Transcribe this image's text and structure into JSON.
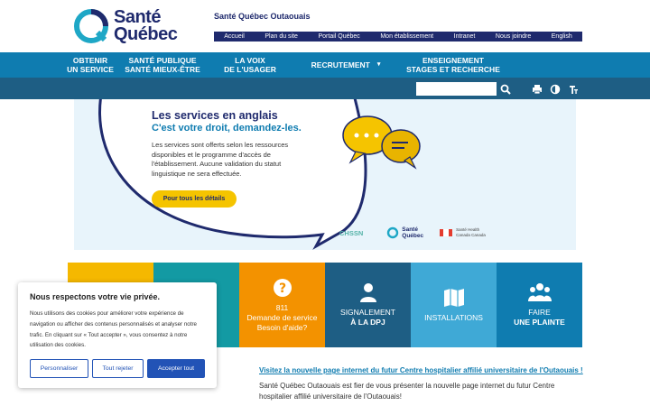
{
  "header": {
    "logo_line1": "Santé",
    "logo_line2": "Québec",
    "site_name": "Santé Québec Outaouais",
    "util_links": [
      "Accueil",
      "Plan du site",
      "Portail Québec",
      "Mon établissement",
      "Intranet",
      "Nous joindre",
      "English"
    ]
  },
  "mainnav": {
    "items": [
      {
        "line1": "OBTENIR",
        "line2": "UN SERVICE"
      },
      {
        "line1": "SANTÉ PUBLIQUE",
        "line2": "SANTÉ MIEUX-ÊTRE"
      },
      {
        "line1": "LA VOIX",
        "line2": "DE L'USAGER"
      },
      {
        "line1": "RECRUTEMENT",
        "line2": ""
      },
      {
        "line1": "ENSEIGNEMENT",
        "line2": "STAGES ET RECHERCHE"
      }
    ],
    "dropdown_marker": "▾"
  },
  "toolbar": {
    "search_placeholder": "",
    "icons": [
      "search-icon",
      "print-icon",
      "contrast-icon",
      "font-size-icon"
    ]
  },
  "banner": {
    "title": "Les services en anglais",
    "subtitle": "C'est votre droit, demandez-les.",
    "body": "Les services sont offerts selon les ressources disponibles et le programme d'accès de l'établissement. Aucune validation du statut linguistique ne sera effectuée.",
    "button": "Pour tous les détails",
    "logo_chssn": "CHSSN",
    "logo_sq_line1": "Santé",
    "logo_sq_line2": "Québec",
    "logo_hc_line1": "Santé     Health",
    "logo_hc_line2": "Canada   Canada"
  },
  "tiles": [
    {
      "color": "#f5b800",
      "line1": "",
      "line2": "",
      "line3": "",
      "icon": "info-icon"
    },
    {
      "color": "#139aa3",
      "line1": "",
      "line2": "",
      "line3": "",
      "icon": "clinic-icon"
    },
    {
      "color": "#f39200",
      "line1": "811",
      "line2": "Demande de service",
      "line3": "Besoin d'aide?",
      "icon": "question-icon"
    },
    {
      "color": "#1e5e84",
      "line1": "SIGNALEMENT",
      "line2": "À LA DPJ",
      "line3": "",
      "icon": "person-icon"
    },
    {
      "color": "#3fa9d6",
      "line1": "INSTALLATIONS",
      "line2": "",
      "line3": "",
      "icon": "map-icon"
    },
    {
      "color": "#0f7cb0",
      "line1": "FAIRE",
      "line2": "UNE PLAINTE",
      "line3": "",
      "icon": "group-icon"
    }
  ],
  "article": {
    "title": "Visitez la nouvelle page internet du futur Centre hospitalier affilié universitaire de l'Outaouais !",
    "body": "Santé Québec Outaouais est fier de vous présenter la nouvelle page internet du futur Centre hospitalier affilié universitaire de l'Outaouais!"
  },
  "cookie": {
    "title": "Nous respectons votre vie privée.",
    "text": "Nous utilisons des cookies pour améliorer votre expérience de navigation ou afficher des contenus personnalisés et analyser notre trafic. En cliquant sur « Tout accepter », vous consentez à notre utilisation des cookies.",
    "btn_customize": "Personnaliser",
    "btn_reject": "Tout rejeter",
    "btn_accept": "Accepter tout"
  },
  "colors": {
    "navy": "#1f2a6d",
    "nav_blue": "#0f7cb0",
    "subbar": "#1e5e84",
    "yellow": "#f5c400",
    "cookie_button": "#2253b6"
  }
}
